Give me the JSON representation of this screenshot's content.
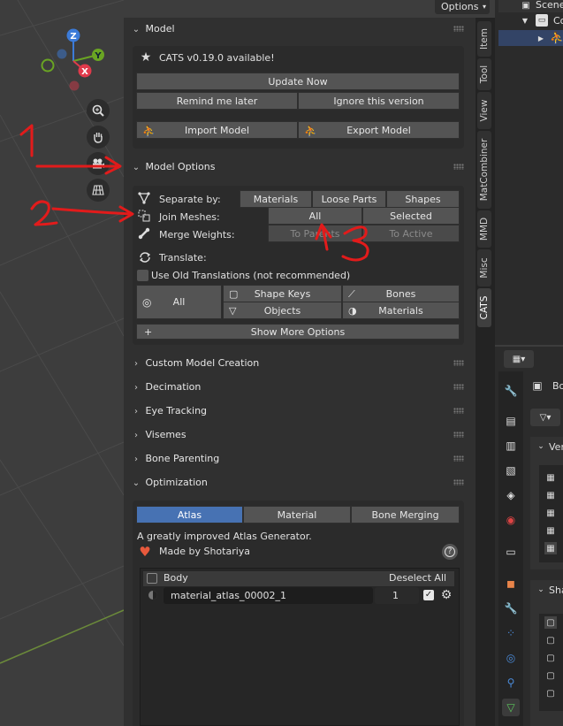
{
  "topbar": {
    "options_label": "Options"
  },
  "tabs": [
    "Item",
    "Tool",
    "View",
    "MatCombiner",
    "MMD",
    "Misc",
    "CATS"
  ],
  "gizmo": {
    "z": "Z",
    "y": "Y",
    "x": "X"
  },
  "model_panel": {
    "title": "Model",
    "update_notice": "CATS v0.19.0 available!",
    "update_now": "Update Now",
    "remind_later": "Remind me later",
    "ignore_version": "Ignore this version",
    "import_model": "Import Model",
    "export_model": "Export Model"
  },
  "model_options": {
    "title": "Model Options",
    "separate_by_label": "Separate by:",
    "separate_buttons": [
      "Materials",
      "Loose Parts",
      "Shapes"
    ],
    "join_meshes_label": "Join Meshes:",
    "join_buttons": [
      "All",
      "Selected"
    ],
    "merge_weights_label": "Merge Weights:",
    "merge_buttons": [
      "To Parents",
      "To Active"
    ],
    "translate_label": "Translate:",
    "old_translations": "Use Old Translations (not recommended)",
    "translate_all": "All",
    "shape_keys": "Shape Keys",
    "bones": "Bones",
    "objects": "Objects",
    "materials": "Materials",
    "show_more": "Show More Options"
  },
  "collapsed_panels": [
    "Custom Model Creation",
    "Decimation",
    "Eye Tracking",
    "Visemes",
    "Bone Parenting"
  ],
  "optimization": {
    "title": "Optimization",
    "tabs": [
      "Atlas",
      "Material",
      "Bone Merging"
    ],
    "active_tab": "Atlas",
    "description": "A greatly improved Atlas Generator.",
    "credit": "Made by Shotariya",
    "list_header_name": "Body",
    "list_header_action": "Deselect All",
    "material_name": "material_atlas_00002_1",
    "material_count": "1"
  },
  "annotations": [
    "1",
    "2",
    "3"
  ],
  "outliner": {
    "scene": "Scene",
    "collection": "Co"
  },
  "properties": {
    "partial_1": "Bo",
    "partial_2": "Ver",
    "partial_3": "Sha"
  },
  "colors": {
    "accent": "#4772b3",
    "annotation": "#e21b1b",
    "panel_bg": "#2b2b2b",
    "viewport_bg": "#3d3d3d"
  }
}
